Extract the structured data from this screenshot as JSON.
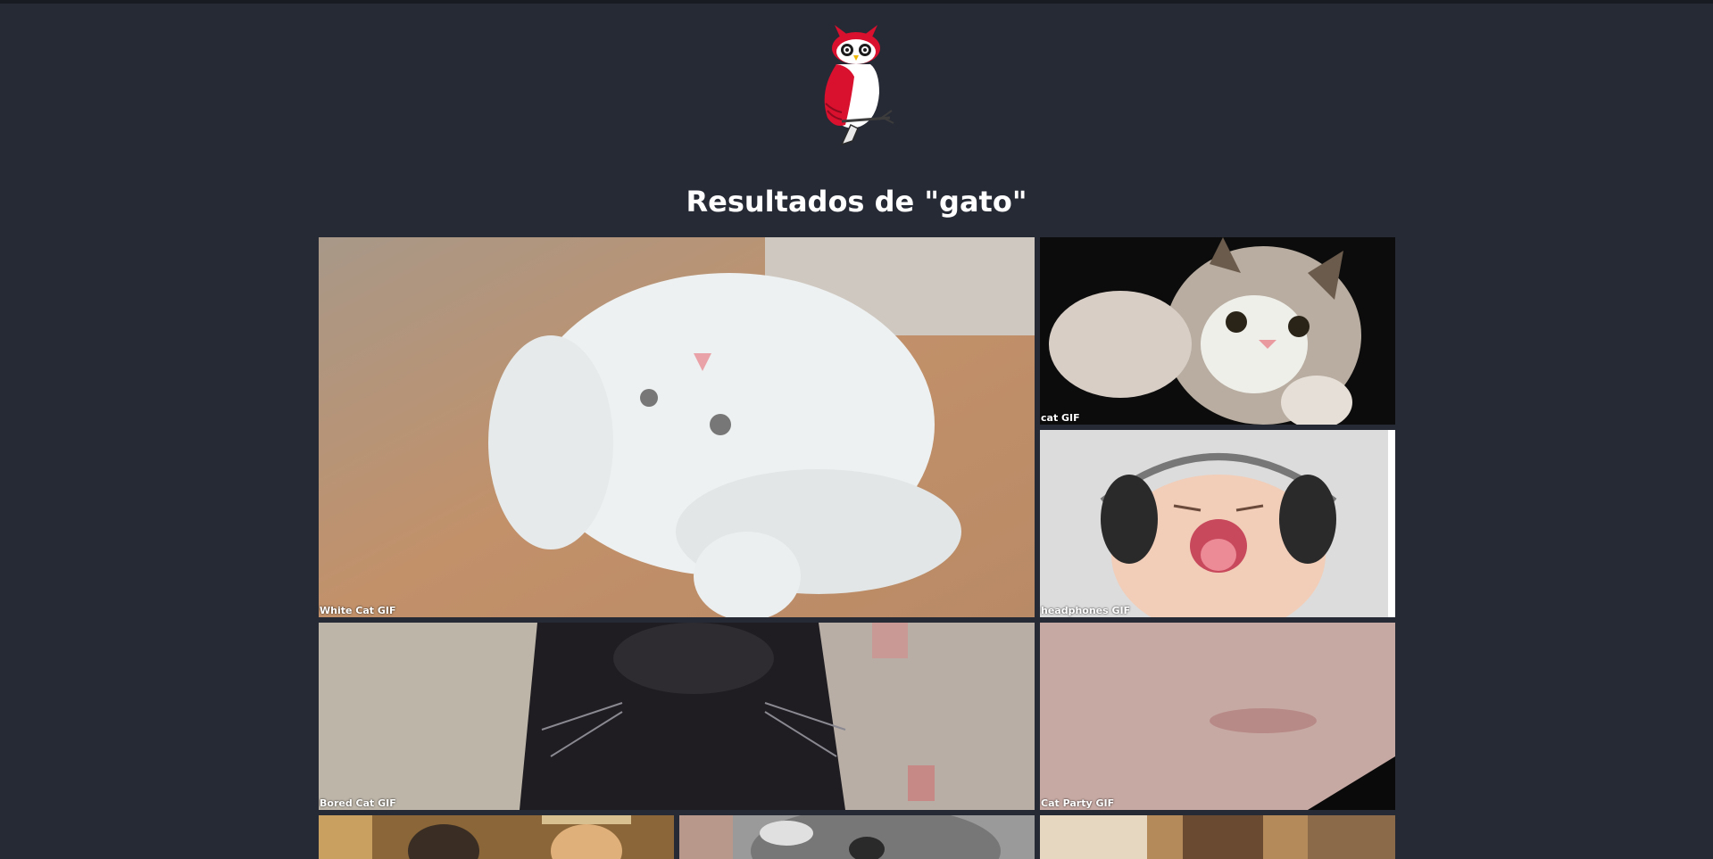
{
  "header": {
    "logo_name": "owl-logo",
    "title": "Resultados de \"gato\""
  },
  "results": [
    {
      "caption": "White Cat GIF"
    },
    {
      "caption": "cat GIF"
    },
    {
      "caption": "headphones GIF"
    },
    {
      "caption": "Bored Cat GIF"
    },
    {
      "caption": "Cat Party GIF"
    },
    {
      "caption": ""
    },
    {
      "caption": ""
    },
    {
      "caption": ""
    }
  ],
  "colors": {
    "background": "#262a35",
    "title_text": "#ffffff",
    "logo_accent": "#e0102d"
  }
}
